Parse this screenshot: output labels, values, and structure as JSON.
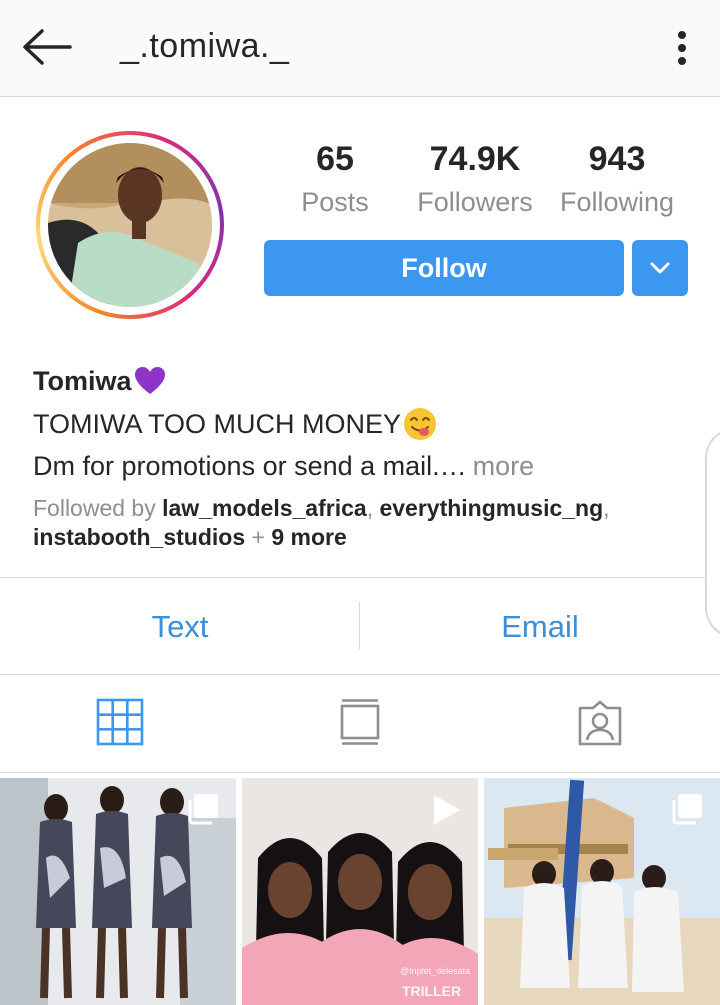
{
  "header": {
    "username": "_.tomiwa._",
    "back_icon": "arrow-left-icon",
    "menu_icon": "more-vertical-icon"
  },
  "stats": {
    "posts": {
      "value": "65",
      "label": "Posts"
    },
    "followers": {
      "value": "74.9K",
      "label": "Followers"
    },
    "following": {
      "value": "943",
      "label": "Following"
    }
  },
  "actions": {
    "follow_label": "Follow",
    "dropdown_icon": "chevron-down-icon",
    "accent_color": "#3b97f0"
  },
  "bio": {
    "name": "Tomiwa",
    "name_emoji": "purple-heart-emoji",
    "line1": "TOMIWA TOO MUCH MONEY",
    "line1_emoji": "yum-face-emoji",
    "line2": "Dm for promotions or send a mail.…",
    "more_label": "more",
    "followed_by_prefix": "Followed by",
    "followed_by": [
      "law_models_africa",
      "everythingmusic_ng",
      "instabooth_studios"
    ],
    "followed_by_extra": "9 more"
  },
  "contact": {
    "text_label": "Text",
    "email_label": "Email"
  },
  "tabs": [
    {
      "icon": "grid-icon",
      "active": true
    },
    {
      "icon": "igtv-icon",
      "active": false
    },
    {
      "icon": "tagged-person-icon",
      "active": false
    }
  ],
  "posts": [
    {
      "type": "carousel",
      "icon": "multiple-posts-icon"
    },
    {
      "type": "video",
      "icon": "play-icon",
      "watermark": "@triplet_delesata",
      "brand": "TRILLER"
    },
    {
      "type": "carousel",
      "icon": "multiple-posts-icon"
    }
  ]
}
